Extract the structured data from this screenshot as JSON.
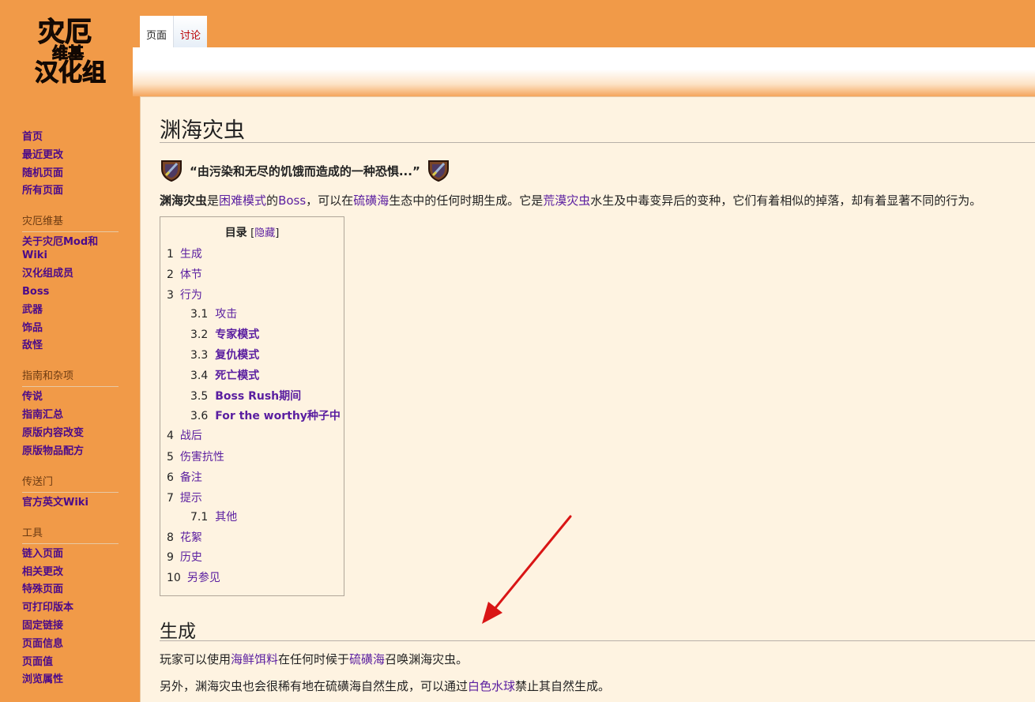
{
  "logo": {
    "line1": "灾厄",
    "line2": "维基",
    "line3": "汉化组"
  },
  "tabs": [
    {
      "label": "页面"
    },
    {
      "label": "讨论"
    }
  ],
  "sidebar": {
    "nav": [
      "首页",
      "最近更改",
      "随机页面",
      "所有页面"
    ],
    "sections": [
      {
        "title": "灾厄维基",
        "items": [
          "关于灾厄Mod和Wiki",
          "汉化组成员",
          "Boss",
          "武器",
          "饰品",
          "敌怪"
        ]
      },
      {
        "title": "指南和杂项",
        "items": [
          "传说",
          "指南汇总",
          "原版内容改变",
          "原版物品配方"
        ]
      },
      {
        "title": "传送门",
        "items": [
          "官方英文Wiki"
        ]
      },
      {
        "title": "工具",
        "items": [
          "链入页面",
          "相关更改",
          "特殊页面",
          "可打印版本",
          "固定链接",
          "页面信息",
          "页面值",
          "浏览属性"
        ]
      }
    ]
  },
  "page": {
    "title": "渊海灾虫",
    "quote": "“由污染和无尽的饥饿而造成的一种恐惧...”",
    "intro": {
      "t1": "渊海灾虫",
      "t2": "是",
      "l1": "困难模式",
      "t3": "的",
      "l2": "Boss",
      "t4": "，可以在",
      "l3": "硫磺海",
      "t5": "生态中的任何时期生成。它是",
      "l4": "荒漠灾虫",
      "t6": "水生及中毒变异后的变种，它们有着相似的掉落，却有着显著不同的行为。"
    },
    "toc": {
      "title": "目录",
      "hide_prefix": "[",
      "hide": "隐藏",
      "hide_suffix": "]",
      "items": [
        {
          "num": "1",
          "text": "生成"
        },
        {
          "num": "2",
          "text": "体节"
        },
        {
          "num": "3",
          "text": "行为"
        },
        {
          "num": "3.1",
          "text": "攻击"
        },
        {
          "num": "3.2",
          "text": "专家模式"
        },
        {
          "num": "3.3",
          "text": "复仇模式"
        },
        {
          "num": "3.4",
          "text": "死亡模式"
        },
        {
          "num": "3.5",
          "text": "Boss Rush期间"
        },
        {
          "num": "3.6",
          "text": "For the worthy种子中"
        },
        {
          "num": "4",
          "text": "战后"
        },
        {
          "num": "5",
          "text": "伤害抗性"
        },
        {
          "num": "6",
          "text": "备注"
        },
        {
          "num": "7",
          "text": "提示"
        },
        {
          "num": "7.1",
          "text": "其他"
        },
        {
          "num": "8",
          "text": "花絮"
        },
        {
          "num": "9",
          "text": "历史"
        },
        {
          "num": "10",
          "text": "另参见"
        }
      ]
    },
    "section_spawn": {
      "heading": "生成",
      "p1": {
        "t1": "玩家可以使用",
        "l1": "海鲜饵料",
        "t2": "在任何时候于",
        "l2": "硫磺海",
        "t3": "召唤渊海灾虫。"
      },
      "p2": {
        "t1": "另外，渊海灾虫也会很稀有地在硫磺海自然生成，可以通过",
        "l1": "白色水球",
        "t2": "禁止其自然生成。"
      }
    }
  },
  "colors": {
    "sidebar_bg": "#f19a48",
    "content_bg": "#fef3e1",
    "link": "#5a1ea0",
    "sidebar_link": "#4b0a8a",
    "annotation_arrow": "#d91515"
  }
}
